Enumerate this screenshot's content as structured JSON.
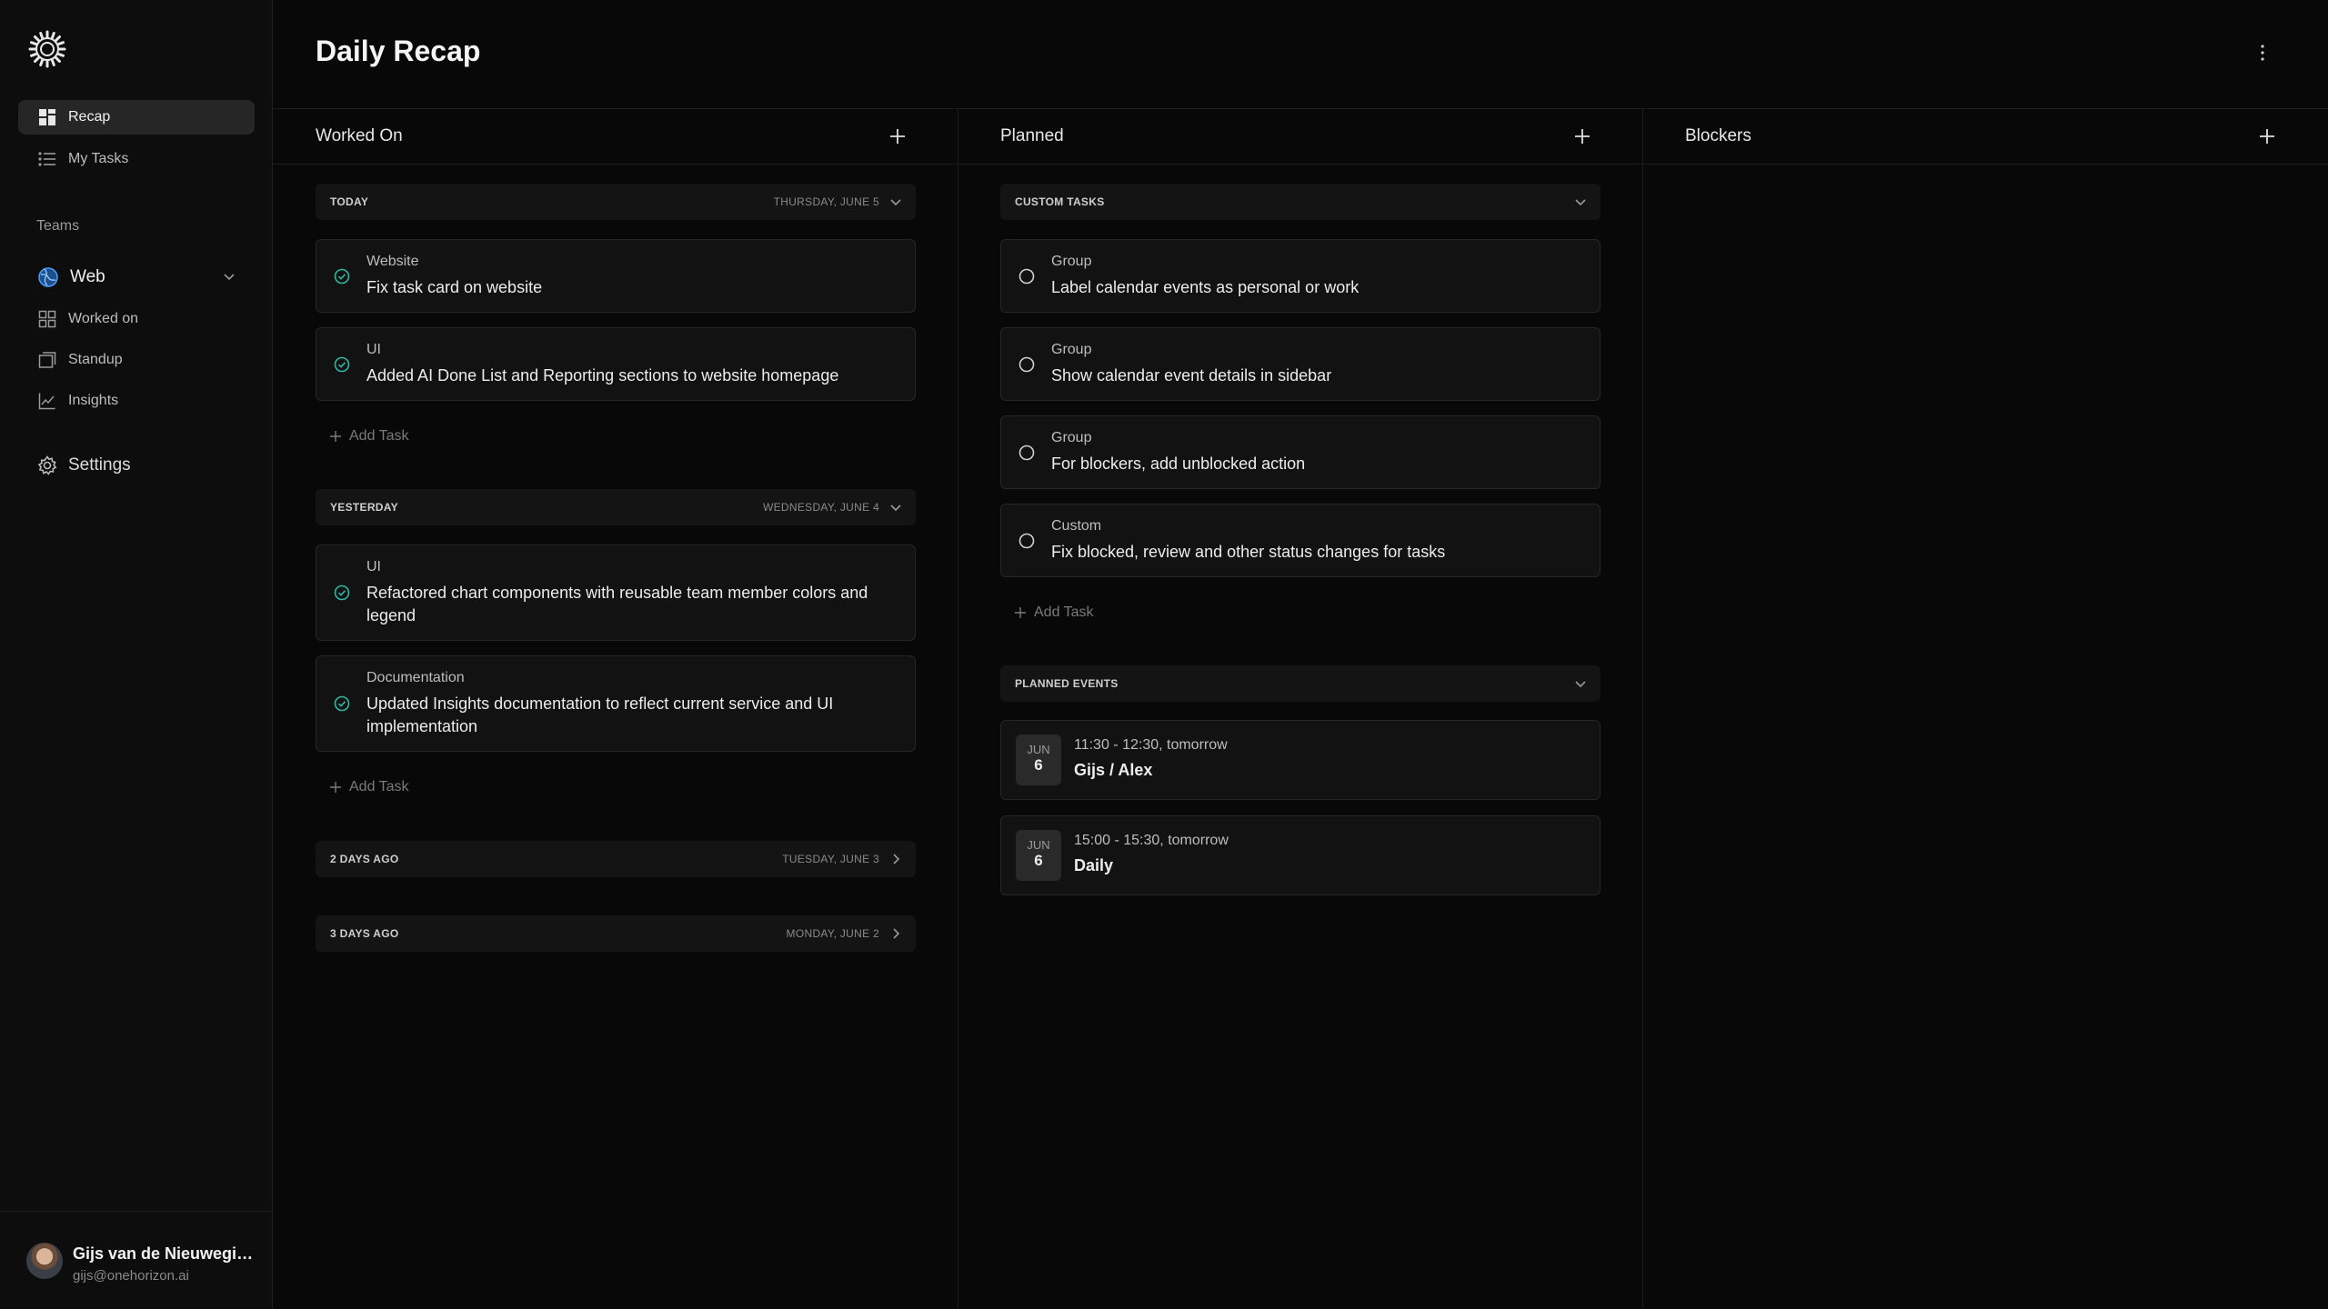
{
  "sidebar": {
    "nav": [
      {
        "label": "Recap",
        "icon": "dashboard-icon",
        "active": true
      },
      {
        "label": "My Tasks",
        "icon": "list-icon",
        "active": false
      }
    ],
    "teams_label": "Teams",
    "team": {
      "name": "Web",
      "icon": "globe-icon"
    },
    "team_items": [
      {
        "label": "Worked on",
        "icon": "grid-icon"
      },
      {
        "label": "Standup",
        "icon": "window-icon"
      },
      {
        "label": "Insights",
        "icon": "chart-line-icon"
      }
    ],
    "settings_label": "Settings",
    "profile": {
      "name": "Gijs van de Nieuwegiessen",
      "email": "gijs@onehorizon.ai"
    }
  },
  "header": {
    "title": "Daily Recap"
  },
  "columns": {
    "worked_on": {
      "title": "Worked On",
      "groups": [
        {
          "label": "TODAY",
          "date": "THURSDAY, JUNE 5",
          "tasks": [
            {
              "category": "Website",
              "title": "Fix task card on website"
            },
            {
              "category": "UI",
              "title": "Added AI Done List and Reporting sections to website homepage"
            }
          ],
          "add_label": "Add Task"
        },
        {
          "label": "YESTERDAY",
          "date": "WEDNESDAY, JUNE 4",
          "tasks": [
            {
              "category": "UI",
              "title": "Refactored chart components with reusable team member colors and legend"
            },
            {
              "category": "Documentation",
              "title": "Updated Insights documentation to reflect current service and UI implementation"
            }
          ],
          "add_label": "Add Task"
        },
        {
          "label": "2 DAYS AGO",
          "date": "TUESDAY, JUNE 3"
        },
        {
          "label": "3 DAYS AGO",
          "date": "MONDAY, JUNE 2"
        }
      ]
    },
    "planned": {
      "title": "Planned",
      "custom_tasks": {
        "label": "CUSTOM TASKS",
        "tasks": [
          {
            "category": "Group",
            "title": "Label calendar events as personal or work"
          },
          {
            "category": "Group",
            "title": "Show calendar event details in sidebar"
          },
          {
            "category": "Group",
            "title": "For blockers, add unblocked action"
          },
          {
            "category": "Custom",
            "title": "Fix blocked, review and other status changes for tasks"
          }
        ],
        "add_label": "Add Task"
      },
      "planned_events": {
        "label": "PLANNED EVENTS",
        "events": [
          {
            "month": "JUN",
            "day": "6",
            "time": "11:30 - 12:30, tomorrow",
            "title": "Gijs / Alex"
          },
          {
            "month": "JUN",
            "day": "6",
            "time": "15:00 - 15:30, tomorrow",
            "title": "Daily"
          }
        ]
      }
    },
    "blockers": {
      "title": "Blockers"
    }
  },
  "colors": {
    "accent_check": "#2fb8a6",
    "background": "#080808",
    "card": "#121212"
  }
}
